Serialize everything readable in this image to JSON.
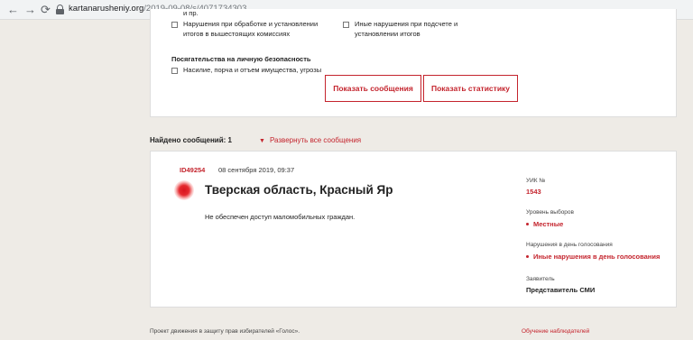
{
  "browser": {
    "back": "←",
    "forward": "→",
    "reload": "⟳",
    "url_host": "kartanarusheniy.org",
    "url_path": "/2019-09-08/s/4071734303",
    "icons": {
      "secure": "lock-icon"
    }
  },
  "filters": {
    "items": [
      {
        "label": "и пр."
      },
      {
        "label": "Нарушения при обработке и установлении"
      },
      {
        "label": "итогов в вышестоящих комиссиях"
      },
      {
        "label": "Иные нарушения при подсчете и"
      },
      {
        "label": "установлении итогов"
      },
      {
        "label": "Насилие, порча и отъем имущества, угрозы"
      }
    ],
    "section_title": "Посягательства на личную безопасность",
    "buttons": {
      "show_messages": "Показать сообщения",
      "show_stats": "Показать статистику"
    }
  },
  "results": {
    "found_label": "Найдено сообщений: 1",
    "expand_label": "Развернуть все сообщения"
  },
  "message": {
    "id": "ID49254",
    "date": "08 сентября 2019, 09:37",
    "region": "Тверская область, Красный Яр",
    "text": "Не обеспечен доступ маломобильных граждан.",
    "uik_label": "УИК №",
    "uik_value": "1543",
    "level_label": "Уровень выборов",
    "level_value": "Местные",
    "violations_label": "Нарушения в день голосования",
    "violations_value": "Иные нарушения в день голосования",
    "applicant_label": "Заявитель",
    "applicant_value": "Представитель СМИ"
  },
  "footer": {
    "left": "Проект движения в защиту прав избирателей «Голос».",
    "right": "Обучение наблюдателей"
  },
  "colors": {
    "accent": "#c4242d",
    "background": "#eeebe6"
  }
}
